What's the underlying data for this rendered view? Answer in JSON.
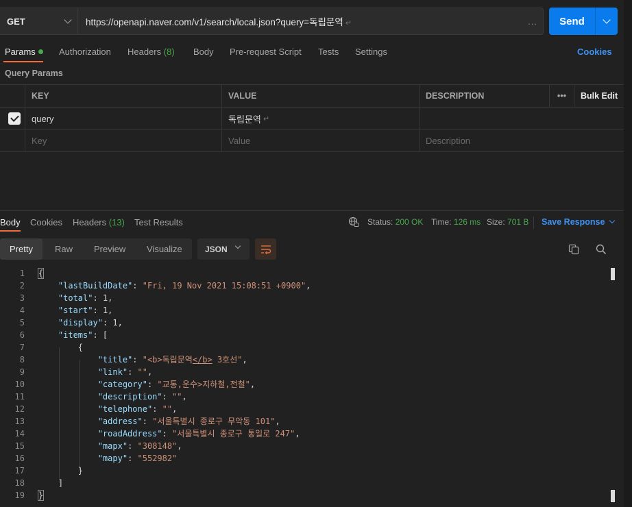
{
  "request": {
    "method": "GET",
    "url": "https://openapi.naver.com/v1/search/local.json?query=독립문역",
    "url_more": "...",
    "send_label": "Send"
  },
  "request_tabs": {
    "params": "Params",
    "authorization": "Authorization",
    "headers": "Headers",
    "headers_count": "(8)",
    "body": "Body",
    "prerequest": "Pre-request Script",
    "tests": "Tests",
    "settings": "Settings",
    "cookies": "Cookies"
  },
  "query_params": {
    "section_label": "Query Params",
    "columns": {
      "key": "KEY",
      "value": "VALUE",
      "description": "DESCRIPTION",
      "more": "•••",
      "bulk_edit": "Bulk Edit"
    },
    "row": {
      "key": "query",
      "value": "독립문역",
      "checked": true
    },
    "placeholders": {
      "key": "Key",
      "value": "Value",
      "description": "Description"
    }
  },
  "response_tabs": {
    "body": "Body",
    "cookies": "Cookies",
    "headers": "Headers",
    "headers_count": "(13)",
    "test_results": "Test Results"
  },
  "status": {
    "status_label": "Status:",
    "status_value": "200 OK",
    "time_label": "Time:",
    "time_value": "126 ms",
    "size_label": "Size:",
    "size_value": "701 B",
    "save_response": "Save Response"
  },
  "view": {
    "pretty": "Pretty",
    "raw": "Raw",
    "preview": "Preview",
    "visualize": "Visualize",
    "format": "JSON"
  },
  "response_body": {
    "lastBuildDate": "Fri, 19 Nov 2021 15:08:51 +0900",
    "total": "1",
    "start": "1",
    "display": "1",
    "item": {
      "title_pre": "\"<b>",
      "title_mid": "독립문역",
      "title_close": "</b>",
      "title_post": " 3호선\"",
      "link": "\"\"",
      "category": "\"교통,운수>지하철,전철\"",
      "description": "\"\"",
      "telephone": "\"\"",
      "address": "\"서울특별시 종로구 무악동 101\"",
      "roadAddress": "\"서울특별시 종로구 통일로 247\"",
      "mapx": "\"308148\"",
      "mapy": "\"552982\""
    }
  }
}
